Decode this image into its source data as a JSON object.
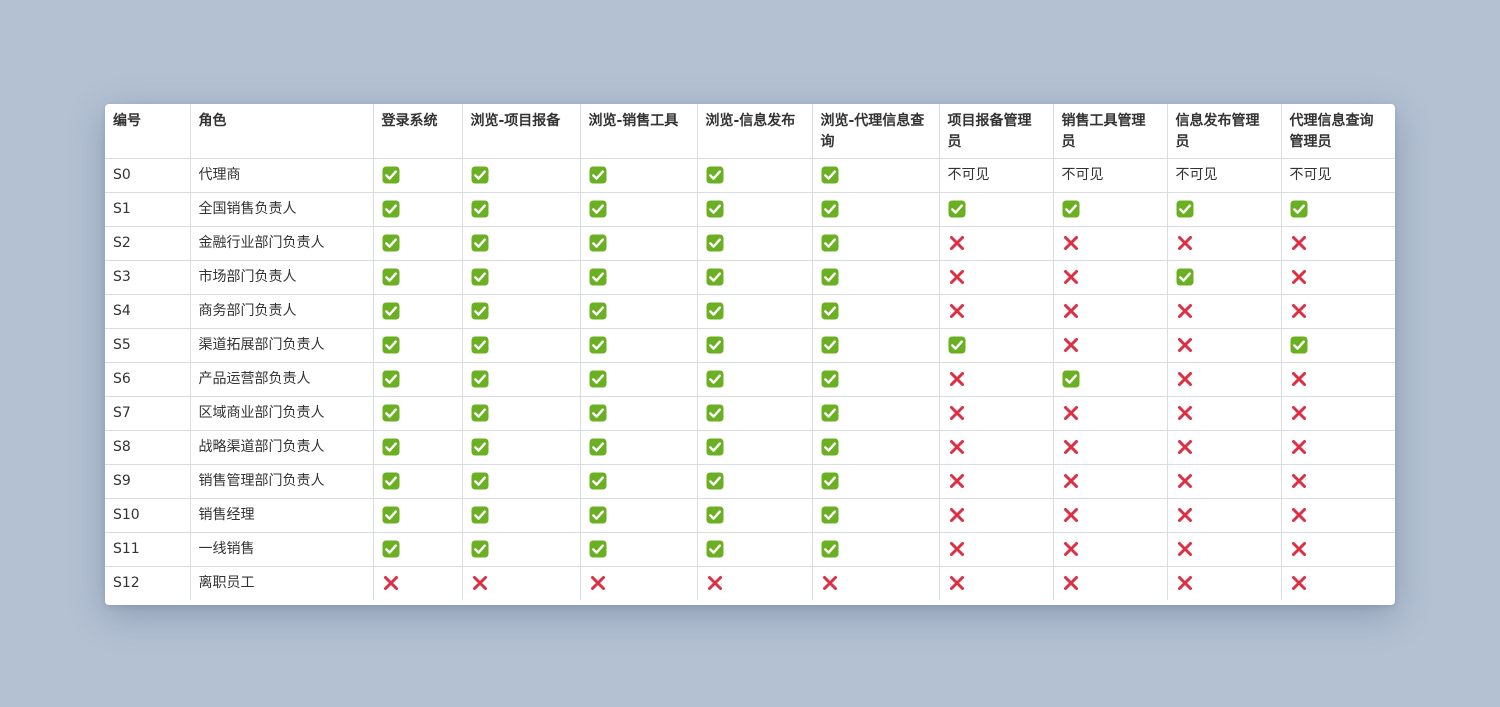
{
  "table": {
    "headers": [
      "编号",
      "角色",
      "登录系统",
      "浏览-项目报备",
      "浏览-销售工具",
      "浏览-信息发布",
      "浏览-代理信息查询",
      "项目报备管理员",
      "销售工具管理员",
      "信息发布管理员",
      "代理信息查询管理员"
    ],
    "rows": [
      {
        "id": "S0",
        "role": "代理商",
        "cells": [
          "yes",
          "yes",
          "yes",
          "yes",
          "yes",
          "不可见",
          "不可见",
          "不可见",
          "不可见"
        ]
      },
      {
        "id": "S1",
        "role": "全国销售负责人",
        "cells": [
          "yes",
          "yes",
          "yes",
          "yes",
          "yes",
          "yes",
          "yes",
          "yes",
          "yes"
        ]
      },
      {
        "id": "S2",
        "role": "金融行业部门负责人",
        "cells": [
          "yes",
          "yes",
          "yes",
          "yes",
          "yes",
          "no",
          "no",
          "no",
          "no"
        ]
      },
      {
        "id": "S3",
        "role": "市场部门负责人",
        "cells": [
          "yes",
          "yes",
          "yes",
          "yes",
          "yes",
          "no",
          "no",
          "yes",
          "no"
        ]
      },
      {
        "id": "S4",
        "role": "商务部门负责人",
        "cells": [
          "yes",
          "yes",
          "yes",
          "yes",
          "yes",
          "no",
          "no",
          "no",
          "no"
        ]
      },
      {
        "id": "S5",
        "role": "渠道拓展部门负责人",
        "cells": [
          "yes",
          "yes",
          "yes",
          "yes",
          "yes",
          "yes",
          "no",
          "no",
          "yes"
        ]
      },
      {
        "id": "S6",
        "role": "产品运营部负责人",
        "cells": [
          "yes",
          "yes",
          "yes",
          "yes",
          "yes",
          "no",
          "yes",
          "no",
          "no"
        ]
      },
      {
        "id": "S7",
        "role": "区域商业部门负责人",
        "cells": [
          "yes",
          "yes",
          "yes",
          "yes",
          "yes",
          "no",
          "no",
          "no",
          "no"
        ]
      },
      {
        "id": "S8",
        "role": "战略渠道部门负责人",
        "cells": [
          "yes",
          "yes",
          "yes",
          "yes",
          "yes",
          "no",
          "no",
          "no",
          "no"
        ]
      },
      {
        "id": "S9",
        "role": "销售管理部门负责人",
        "cells": [
          "yes",
          "yes",
          "yes",
          "yes",
          "yes",
          "no",
          "no",
          "no",
          "no"
        ]
      },
      {
        "id": "S10",
        "role": "销售经理",
        "cells": [
          "yes",
          "yes",
          "yes",
          "yes",
          "yes",
          "no",
          "no",
          "no",
          "no"
        ]
      },
      {
        "id": "S11",
        "role": "一线销售",
        "cells": [
          "yes",
          "yes",
          "yes",
          "yes",
          "yes",
          "no",
          "no",
          "no",
          "no"
        ]
      },
      {
        "id": "S12",
        "role": "离职员工",
        "cells": [
          "no",
          "no",
          "no",
          "no",
          "no",
          "no",
          "no",
          "no",
          "no"
        ]
      }
    ]
  },
  "icons": {
    "yes": "check-mark-icon",
    "no": "cross-mark-icon"
  },
  "colors": {
    "check_fill": "#6bb023",
    "cross": "#dd2e44",
    "background": "#b3c1d3"
  }
}
